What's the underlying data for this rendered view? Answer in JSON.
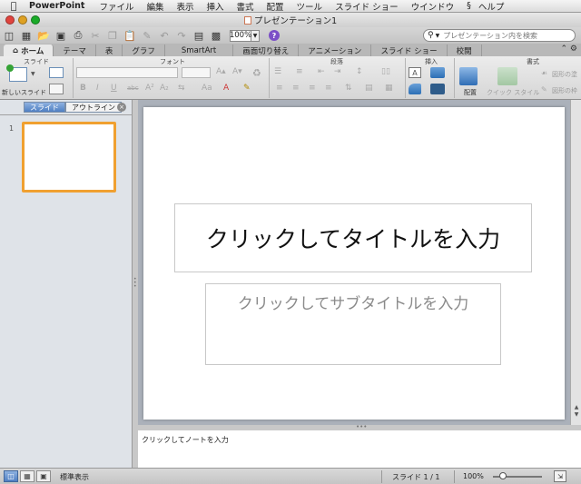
{
  "menubar": {
    "app": "PowerPoint",
    "items": [
      "ファイル",
      "編集",
      "表示",
      "挿入",
      "書式",
      "配置",
      "ツール",
      "スライド ショー",
      "ウインドウ",
      "ヘルプ"
    ]
  },
  "window": {
    "title": "プレゼンテーション1"
  },
  "toolbar": {
    "zoom_value": "100%",
    "search_placeholder": "プレゼンテーション内を検索"
  },
  "ribbon": {
    "tabs": [
      "ホーム",
      "テーマ",
      "表",
      "グラフ",
      "SmartArt",
      "画面切り替え",
      "アニメーション",
      "スライド ショー",
      "校閲"
    ],
    "groups": {
      "slides": "スライド",
      "font": "フォント",
      "paragraph": "段落",
      "insert": "挿入",
      "format": "書式"
    },
    "new_slide_label": "新しいスライド",
    "arrange_label": "配置",
    "quick_style_label": "クイック スタイル",
    "shape_fill_label": "図形の塗",
    "shape_line_label": "図形の枠"
  },
  "leftpane": {
    "tabs": [
      "スライド",
      "アウトライン"
    ],
    "slide_number": "1"
  },
  "slide": {
    "title_placeholder": "クリックしてタイトルを入力",
    "subtitle_placeholder": "クリックしてサブタイトルを入力"
  },
  "notes": {
    "placeholder": "クリックしてノートを入力"
  },
  "statusbar": {
    "view_name": "標準表示",
    "slide_indicator": "スライド 1 / 1",
    "zoom": "100%"
  },
  "colors": {
    "thumb_selection": "#f0a030",
    "active_tab_blue": "#4f7fc3"
  }
}
